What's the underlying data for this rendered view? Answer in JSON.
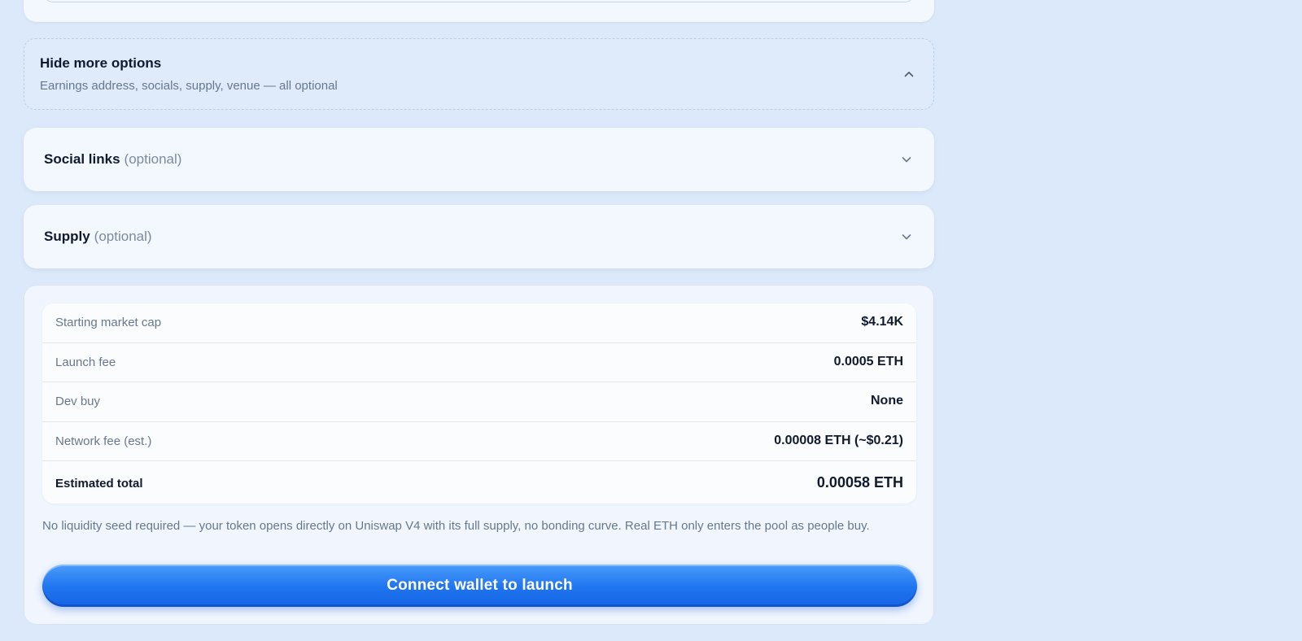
{
  "more_options": {
    "title": "Hide more options",
    "subtitle": "Earnings address, socials, supply, venue — all optional",
    "icon": "chevron-up-icon"
  },
  "social_links": {
    "label": "Social links",
    "optional": "(optional)",
    "icon": "chevron-down-icon"
  },
  "supply": {
    "label": "Supply",
    "optional": "(optional)",
    "icon": "chevron-down-icon"
  },
  "summary": {
    "rows": [
      {
        "key": "Starting market cap",
        "value": "$4.14K"
      },
      {
        "key": "Launch fee",
        "value": "0.0005 ETH"
      },
      {
        "key": "Dev buy",
        "value": "None"
      },
      {
        "key": "Network fee (est.)",
        "value": "0.00008 ETH (~$0.21)"
      },
      {
        "key": "Estimated total",
        "value": "0.00058 ETH"
      }
    ],
    "note": "No liquidity seed required — your token opens directly on Uniswap V4 with its full supply, no bonding curve. Real ETH only enters the pool as people buy.",
    "cta_label": "Connect wallet to launch"
  },
  "colors": {
    "background": "#dbe9fa",
    "accent": "#1f74ef",
    "muted_text": "#66788f"
  }
}
